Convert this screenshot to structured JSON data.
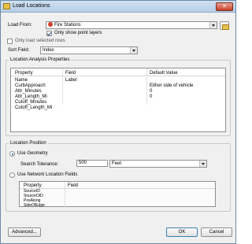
{
  "window": {
    "title": "Load Locations",
    "close_glyph": "✕"
  },
  "load_from": {
    "label": "Load From:",
    "value": "Fire Stations",
    "only_points_label": "Only show point layers",
    "only_points_checked": true
  },
  "only_selected_label": "Only load selected rows",
  "only_selected_checked": false,
  "sort_field": {
    "label": "Sort Field:",
    "value": "Index"
  },
  "properties_group": {
    "title": "Location Analysis Properties",
    "headers": [
      "Property",
      "Field",
      "Default Value"
    ],
    "rows": [
      [
        "Name",
        "Label",
        ""
      ],
      [
        "CurbApproach",
        "",
        "Either side of vehicle"
      ],
      [
        "Attr_Minutes",
        "",
        "0"
      ],
      [
        "Attr_Length_Mi",
        "",
        "0"
      ],
      [
        "Cutoff_Minutes",
        "",
        ""
      ],
      [
        "Cutoff_Length_Mi",
        "",
        ""
      ]
    ]
  },
  "location_position": {
    "title": "Location Position",
    "use_geometry_label": "Use Geometry",
    "use_geometry_selected": true,
    "tolerance_label": "Search Tolerance:",
    "tolerance_value": "500",
    "tolerance_unit": "Feet",
    "use_network_label": "Use Network Location Fields",
    "use_network_selected": false,
    "network_headers": [
      "Property",
      "Field"
    ],
    "network_rows": [
      "SourceID",
      "SourceOID",
      "PosAlong",
      "SideOfEdge"
    ]
  },
  "buttons": {
    "advanced": "Advanced...",
    "ok": "OK",
    "cancel": "Cancel"
  },
  "icons": {
    "app": "layer-icon",
    "folder": "folder-open-icon",
    "fire": "fire-station-icon"
  }
}
